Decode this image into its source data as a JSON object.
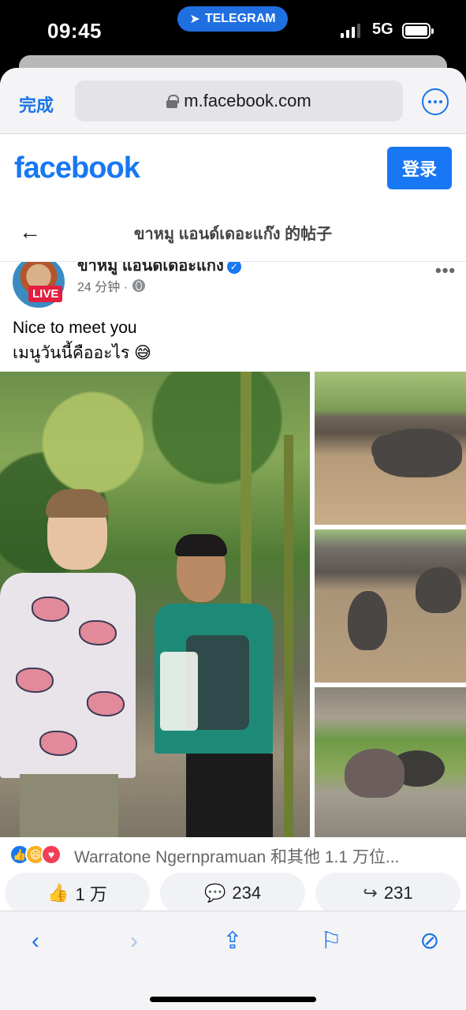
{
  "status_bar": {
    "time": "09:45",
    "app_pill": "TELEGRAM",
    "network": "5G"
  },
  "browser": {
    "done_label": "完成",
    "url": "m.facebook.com"
  },
  "facebook": {
    "logo": "facebook",
    "login_label": "登录",
    "page_title": "ขาหมู แอนด์เดอะแก๊ง 的帖子"
  },
  "post": {
    "author": "ขาหมู แอนด์เดอะแก๊ง",
    "live_badge": "LIVE",
    "time": "24 分钟 ·",
    "text_line1": "Nice to meet you",
    "text_line2": "เมนูวันนี้คืออะไร 😅",
    "reactions_text": "Warratone Ngernpramuan 和其他 1.1 万位...",
    "like_count": "1 万",
    "comment_count": "234",
    "share_count": "231"
  },
  "icons": {
    "accent": "#1877f2",
    "browser_accent": "#1a73e8"
  }
}
